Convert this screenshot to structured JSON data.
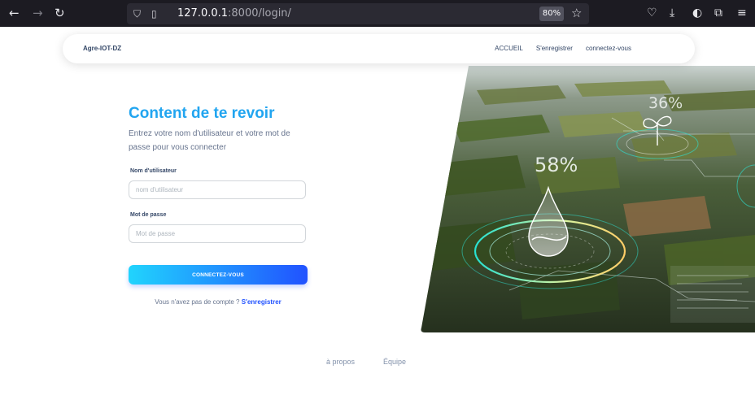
{
  "browser": {
    "url_host": "127.0.0.1",
    "url_rest": ":8000/login/",
    "zoom": "80%"
  },
  "navbar": {
    "brand": "Agre-IOT-DZ",
    "links": [
      "ACCUEIL",
      "S'enregistrer",
      "connectez-vous"
    ]
  },
  "login": {
    "title": "Content de te revoir",
    "subtitle": "Entrez votre nom d'utilisateur et votre mot de passe pour vous connecter",
    "username_label": "Nom d'utilisateur",
    "username_placeholder": "nom d'utilisateur",
    "password_label": "Mot de passe",
    "password_placeholder": "Mot de passe",
    "submit_label": "CONNECTEZ-VOUS",
    "no_account_text": "Vous n'avez pas de compte ?",
    "signup_link": "S'enregistrer"
  },
  "hero": {
    "moisture_value": "58%",
    "growth_value": "36%"
  },
  "footer": {
    "links": [
      "à propos",
      "Équipe"
    ]
  },
  "colors": {
    "accent": "#21a5f0",
    "gradient_start": "#21d4fd",
    "gradient_end": "#2152ff",
    "text_dark": "#344767",
    "text_muted": "#67748e"
  }
}
